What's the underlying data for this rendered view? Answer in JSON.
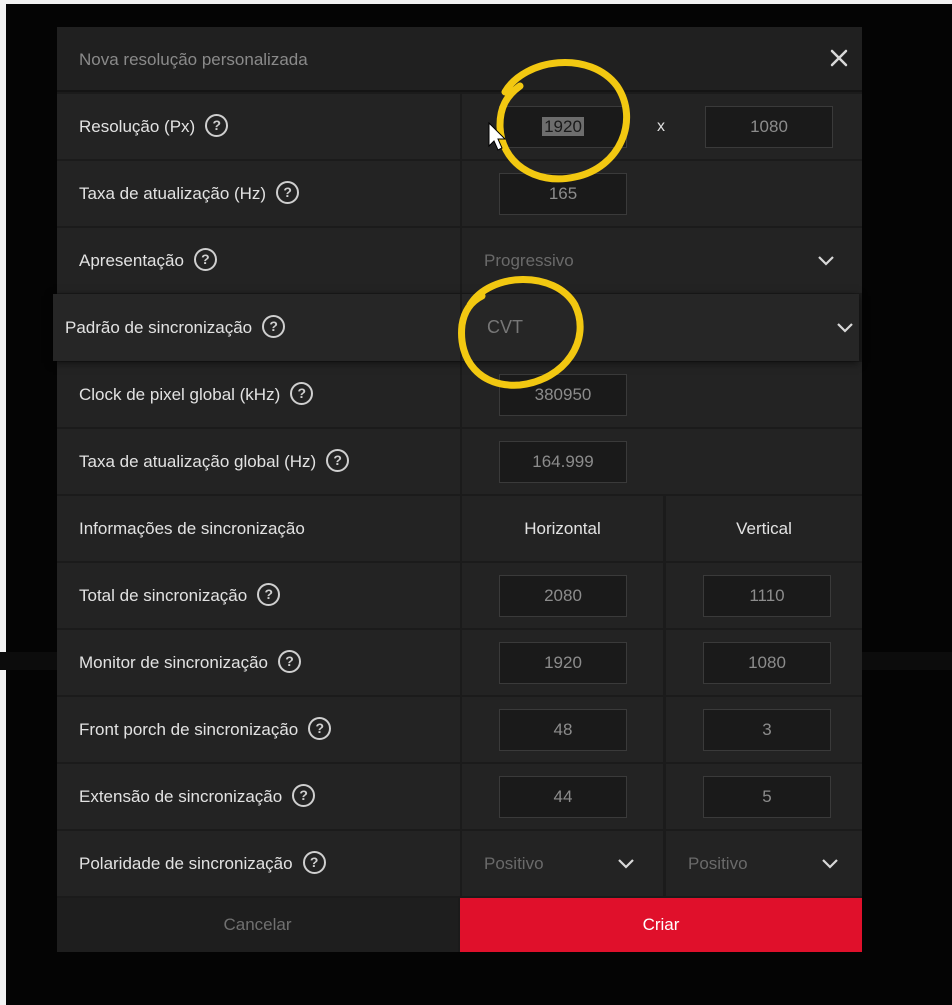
{
  "dialog": {
    "title": "Nova resolução personalizada",
    "close_icon": "close-icon"
  },
  "resolution": {
    "label": "Resolução (Px)",
    "width": "1920",
    "separator": "x",
    "height": "1080"
  },
  "refresh_rate": {
    "label": "Taxa de atualização (Hz)",
    "value": "165"
  },
  "presentation": {
    "label": "Apresentação",
    "value": "Progressivo"
  },
  "sync_standard": {
    "label": "Padrão de sincronização",
    "value": "CVT"
  },
  "pixel_clock": {
    "label": "Clock de pixel global (kHz)",
    "value": "380950"
  },
  "global_refresh": {
    "label": "Taxa de atualização global (Hz)",
    "value": "164.999"
  },
  "sync_info": {
    "label": "Informações de sincronização",
    "horizontal_header": "Horizontal",
    "vertical_header": "Vertical"
  },
  "sync_rows": [
    {
      "label": "Total de sincronização",
      "h": "2080",
      "v": "1110"
    },
    {
      "label": "Monitor de sincronização",
      "h": "1920",
      "v": "1080"
    },
    {
      "label": "Front porch de sincronização",
      "h": "48",
      "v": "3"
    },
    {
      "label": "Extensão de sincronização",
      "h": "44",
      "v": "5"
    }
  ],
  "polarity": {
    "label": "Polaridade de sincronização",
    "h": "Positivo",
    "v": "Positivo"
  },
  "help_glyph": "?",
  "buttons": {
    "cancel": "Cancelar",
    "create": "Criar"
  },
  "colors": {
    "accent": "#e0102b",
    "annotation": "#f2c811"
  }
}
